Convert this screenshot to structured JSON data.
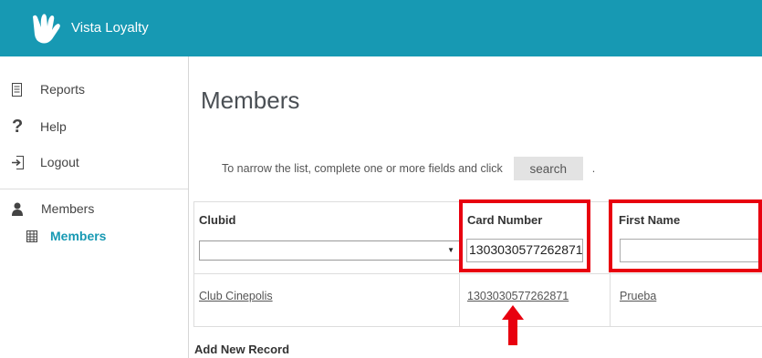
{
  "header": {
    "app_title": "Vista Loyalty",
    "background_color": "#1799b3"
  },
  "sidebar": {
    "items": [
      {
        "label": "Reports",
        "icon": "document-icon"
      },
      {
        "label": "Help",
        "icon": "question-mark-icon"
      },
      {
        "label": "Logout",
        "icon": "logout-icon"
      },
      {
        "label": "Members",
        "icon": "user-icon"
      },
      {
        "label": "Members",
        "icon": "grid-icon",
        "active": true
      }
    ]
  },
  "main": {
    "title": "Members",
    "hint_text": "To narrow the list, complete one or more fields and click",
    "search_label": "search",
    "hint_suffix": ".",
    "table": {
      "columns": [
        {
          "header": "Clubid",
          "filter_type": "select",
          "filter_value": ""
        },
        {
          "header": "Card Number",
          "filter_type": "text",
          "filter_value": "1303030577262871"
        },
        {
          "header": "First Name",
          "filter_type": "text",
          "filter_value": ""
        }
      ],
      "rows": [
        {
          "clubid": "Club Cinepolis",
          "card_number": "1303030577262871",
          "first_name": "Prueba"
        }
      ]
    },
    "add_new_record": "Add New Record"
  },
  "annotations": {
    "color": "#e8000f"
  }
}
